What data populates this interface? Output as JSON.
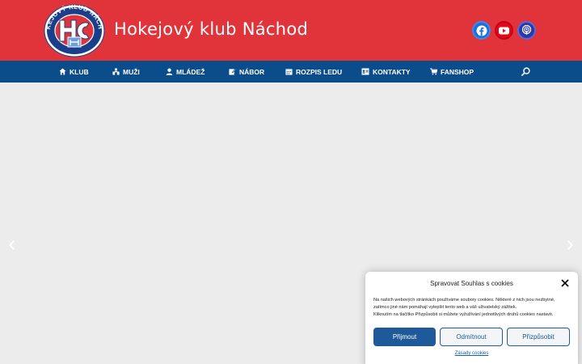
{
  "header": {
    "site_title": "Hokejový klub Náchod",
    "logo_text": "HOKEJOVÝ KLUB NÁCHOD",
    "social": [
      {
        "name": "facebook",
        "icon": "facebook-icon",
        "color": "#1d6fd6"
      },
      {
        "name": "youtube",
        "icon": "youtube-icon",
        "color": "#e3091b"
      },
      {
        "name": "podcast",
        "icon": "podcast-icon",
        "color": "#2a39a8"
      }
    ]
  },
  "nav": {
    "items": [
      {
        "label": "KLUB",
        "icon": "home-icon"
      },
      {
        "label": "MUŽI",
        "icon": "team-icon"
      },
      {
        "label": "MLÁDEŽ",
        "icon": "user-icon"
      },
      {
        "label": "NÁBOR",
        "icon": "edit-icon"
      },
      {
        "label": "ROZPIS LEDU",
        "icon": "calendar-icon"
      },
      {
        "label": "KONTAKTY",
        "icon": "contact-card-icon"
      },
      {
        "label": "FANSHOP",
        "icon": "cart-icon"
      }
    ],
    "search_icon": "search-icon",
    "background": "#0b4d8a"
  },
  "slider": {
    "prev_icon": "chevron-left-icon",
    "next_icon": "chevron-right-icon"
  },
  "cookie": {
    "title": "Spravovat Souhlas s cookies",
    "text_line1": "Na našich webových stránkách používáme soubory cookies. Některé z nich jsou nezbytné,",
    "text_line2": "zatímco jiné nám pomáhají vylepšit tento web a váš uživatelský zážitek.",
    "text_line3": "Kliknutím na tlačítko Přizpůsobit si můžete vyžužívání jednotlivých druhů cookies nastavit.",
    "accept": "Přijmout",
    "deny": "Odmítnout",
    "customize": "Přizpůsobit",
    "policy_link": "Zásady cookies"
  },
  "colors": {
    "header_red": "#e0343a",
    "nav_blue": "#0b4d8a",
    "accent_blue": "#1e5a99"
  }
}
